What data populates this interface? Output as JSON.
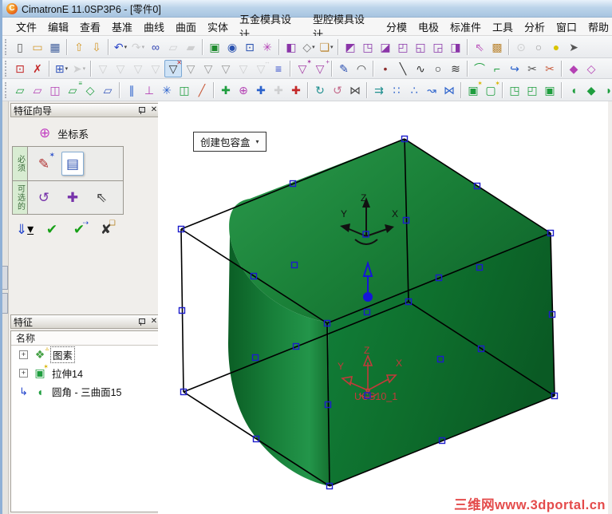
{
  "window": {
    "title": "CimatronE 11.0SP3P6 - [零件0]",
    "logo_glyph": "C"
  },
  "menu": {
    "items": [
      "文件",
      "编辑",
      "查看",
      "基准",
      "曲线",
      "曲面",
      "实体",
      "五金模具设计",
      "型腔模具设计",
      "分模",
      "电极",
      "标准件",
      "工具",
      "分析",
      "窗口",
      "帮助"
    ]
  },
  "toolbars": {
    "row1": [
      {
        "grip": 1
      },
      {
        "n": "new-document-icon",
        "g": "▯",
        "c": "#555"
      },
      {
        "n": "open-document-icon",
        "g": "▭",
        "c": "#d49a2e"
      },
      {
        "n": "save-document-icon",
        "g": "▦",
        "c": "#44629e"
      },
      {
        "sep": 1
      },
      {
        "n": "import-file-icon",
        "g": "⇧",
        "c": "#d49a2e"
      },
      {
        "n": "export-file-icon",
        "g": "⇩",
        "c": "#d49a2e"
      },
      {
        "sep": 1
      },
      {
        "n": "undo-icon",
        "g": "↶",
        "c": "#2b46c8",
        "dd": 1
      },
      {
        "n": "redo-icon",
        "g": "↷",
        "c": "#999",
        "dd": 1,
        "d": 1
      },
      {
        "n": "view-sync-icon",
        "g": "∞",
        "c": "#3346b4"
      },
      {
        "n": "copy-view-icon",
        "g": "▱",
        "c": "#999",
        "d": 1
      },
      {
        "n": "paste-view-icon",
        "g": "▰",
        "c": "#999",
        "d": 1
      },
      {
        "sep": 1
      },
      {
        "n": "render-window-icon",
        "g": "▣",
        "c": "#1d8a2d"
      },
      {
        "n": "zoom-selected-icon",
        "g": "◉",
        "c": "#2a52b0"
      },
      {
        "n": "zoom-window-icon",
        "g": "⊡",
        "c": "#2a52b0"
      },
      {
        "n": "rotate-view-icon",
        "g": "✳",
        "c": "#b441b4"
      },
      {
        "sep": 1
      },
      {
        "n": "shaded-display-icon",
        "g": "◧",
        "c": "#8a35a8"
      },
      {
        "n": "wireframe-display-icon",
        "g": "◇",
        "c": "#777",
        "dd": 1
      },
      {
        "n": "pick-display-icon",
        "g": "❏",
        "c": "#bd8a3a",
        "dd": 1
      },
      {
        "sep": 1
      },
      {
        "n": "view-iso-icon",
        "g": "◩",
        "c": "#8a35a8"
      },
      {
        "n": "view-front-icon",
        "g": "◳",
        "c": "#8a35a8"
      },
      {
        "n": "view-back-icon",
        "g": "◪",
        "c": "#8a35a8"
      },
      {
        "n": "view-left-icon",
        "g": "◰",
        "c": "#8a35a8"
      },
      {
        "n": "view-right-icon",
        "g": "◱",
        "c": "#8a35a8"
      },
      {
        "n": "view-top-icon",
        "g": "◲",
        "c": "#8a35a8"
      },
      {
        "n": "view-bottom-icon",
        "g": "◨",
        "c": "#8a35a8"
      },
      {
        "sep": 1
      },
      {
        "n": "orient-sketch-icon",
        "g": "⇖",
        "c": "#bb55bb"
      },
      {
        "n": "lock-orientation-icon",
        "g": "▩",
        "c": "#bd8a3a"
      },
      {
        "sep": 1
      },
      {
        "n": "ghost-display-icon",
        "g": "⊙",
        "c": "#999",
        "d": 1
      },
      {
        "n": "light-off-icon",
        "g": "○",
        "c": "#999"
      },
      {
        "n": "light-on-icon",
        "g": "●",
        "c": "#d9c400"
      },
      {
        "n": "pick-arrow-icon",
        "g": "➤",
        "c": "#555"
      }
    ],
    "row2": [
      {
        "grip": 1
      },
      {
        "n": "frame-pick-icon",
        "g": "⊡",
        "c": "#c42828"
      },
      {
        "n": "cancel-pick-icon",
        "g": "✗",
        "c": "#c42828"
      },
      {
        "sep": 1
      },
      {
        "n": "add-pick-icon",
        "g": "⊞",
        "c": "#3355bb",
        "dd": 1
      },
      {
        "n": "special-pick-icon",
        "g": "➤",
        "c": "#999",
        "dd": 1,
        "d": 1
      },
      {
        "sep": 1
      },
      {
        "n": "filter-parts-icon",
        "g": "▽",
        "c": "#999",
        "d": 1
      },
      {
        "n": "filter-solids-icon",
        "g": "▽",
        "c": "#999",
        "d": 1
      },
      {
        "n": "filter-faces-icon",
        "g": "▽",
        "c": "#999",
        "d": 1
      },
      {
        "n": "filter-curves-icon",
        "g": "▽",
        "c": "#999",
        "d": 1
      },
      {
        "n": "filter-clear-icon",
        "g": "▽",
        "c": "#333",
        "sel": 1,
        "g2": "✕",
        "c2": "#c42828"
      },
      {
        "n": "filter-edges-icon",
        "g": "▽",
        "c": "#999"
      },
      {
        "n": "filter-points-icon",
        "g": "▽",
        "c": "#999"
      },
      {
        "n": "filter-sketches-icon",
        "g": "▽",
        "c": "#999"
      },
      {
        "n": "filter-dims-icon",
        "g": "▽",
        "c": "#999",
        "d": 1
      },
      {
        "n": "filter-range-icon",
        "g": "▽",
        "c": "#999",
        "d": 1,
        "g2": "↔",
        "c2": "#999"
      },
      {
        "n": "filter-settings-icon",
        "g": "≡",
        "c": "#2b46c8"
      },
      {
        "sep": 1
      },
      {
        "n": "quick-filter-icon",
        "g": "▽",
        "c": "#a53fa5",
        "g2": "✶",
        "c2": "#a53fa5"
      },
      {
        "n": "add-filter-icon",
        "g": "▽",
        "c": "#a53fa5",
        "g2": "+",
        "c2": "#a53fa5"
      },
      {
        "sep": 1
      },
      {
        "n": "sketcher-icon",
        "g": "✎",
        "c": "#2b4fb0"
      },
      {
        "n": "open-profile-icon",
        "g": "◠",
        "c": "#444"
      },
      {
        "sep": 1
      },
      {
        "n": "point-icon",
        "g": "•",
        "c": "#8d2f2f"
      },
      {
        "n": "line-icon",
        "g": "╲",
        "c": "#333"
      },
      {
        "n": "spline-icon",
        "g": "∿",
        "c": "#333"
      },
      {
        "n": "circle-icon",
        "g": "○",
        "c": "#333"
      },
      {
        "n": "coil-icon",
        "g": "≋",
        "c": "#333"
      },
      {
        "sep": 1
      },
      {
        "n": "fillet-curve-icon",
        "g": "⌒",
        "c": "#1f9e3f"
      },
      {
        "n": "corner-round-icon",
        "g": "⌐",
        "c": "#1f9e3f"
      },
      {
        "n": "extend-curve-icon",
        "g": "↪",
        "c": "#2b62cc"
      },
      {
        "n": "trim-curve-icon",
        "g": "✂",
        "c": "#555"
      },
      {
        "n": "divide-curve-icon",
        "g": "✂",
        "c": "#c85a3a"
      },
      {
        "sep": 1
      },
      {
        "n": "drive-surface-icon",
        "g": "◆",
        "c": "#b441b4"
      },
      {
        "n": "ruled-surface-icon",
        "g": "◇",
        "c": "#b441b4"
      }
    ],
    "row3": [
      {
        "grip": 1
      },
      {
        "n": "plane-parallel-icon",
        "g": "▱",
        "c": "#1f9e3f"
      },
      {
        "n": "plane-fold-icon",
        "g": "▱",
        "c": "#b441b4"
      },
      {
        "n": "plane-mid-icon",
        "g": "◫",
        "c": "#b441b4"
      },
      {
        "n": "plane-offset-icon",
        "g": "▱",
        "c": "#1f9e3f",
        "g2": "≡",
        "c2": "#1f9e3f"
      },
      {
        "n": "plane-angle-icon",
        "g": "◇",
        "c": "#1f9e3f"
      },
      {
        "n": "plane-points-icon",
        "g": "▱",
        "c": "#3355bb"
      },
      {
        "sep": 1
      },
      {
        "n": "line-2pts-icon",
        "g": "∥",
        "c": "#2b62cc"
      },
      {
        "n": "axis-point-icon",
        "g": "⊥",
        "c": "#b441b4"
      },
      {
        "n": "axis-center-icon",
        "g": "✳",
        "c": "#2b62cc"
      },
      {
        "n": "axis-planes-icon",
        "g": "◫",
        "c": "#1f9e3f"
      },
      {
        "n": "axis-angle-icon",
        "g": "╱",
        "c": "#c85a3a"
      },
      {
        "sep": 1
      },
      {
        "n": "ucs-geometry-icon",
        "g": "✚",
        "c": "#1f9e3f"
      },
      {
        "n": "ucs-circle-icon",
        "g": "⊕",
        "c": "#b441b4"
      },
      {
        "n": "ucs-origin-icon",
        "g": "✚",
        "c": "#2b62cc"
      },
      {
        "n": "ucs-translate-icon",
        "g": "✚",
        "c": "#999",
        "d": 1
      },
      {
        "n": "ucs-pick-icon",
        "g": "✚",
        "c": "#c42828"
      },
      {
        "sep": 1
      },
      {
        "n": "move-copy-icon",
        "g": "↻",
        "c": "#1f8f8f"
      },
      {
        "n": "rotate-copy-icon",
        "g": "↺",
        "c": "#c46a8a"
      },
      {
        "n": "mirror-icon",
        "g": "⋈",
        "c": "#444"
      },
      {
        "sep": 1
      },
      {
        "n": "translate-icon",
        "g": "⇉",
        "c": "#1f8f8f"
      },
      {
        "n": "pattern-grid-icon",
        "g": "∷",
        "c": "#2b62cc"
      },
      {
        "n": "pattern-radial-icon",
        "g": "∴",
        "c": "#2b62cc"
      },
      {
        "n": "pattern-curve-icon",
        "g": "↝",
        "c": "#2b62cc"
      },
      {
        "n": "mirror-pattern-icon",
        "g": "⋈",
        "c": "#2b62cc"
      },
      {
        "sep": 1
      },
      {
        "n": "new-solid-icon",
        "g": "▣",
        "c": "#1f9e3f",
        "g2": "✶",
        "c2": "#d8b400"
      },
      {
        "n": "new-sheet-icon",
        "g": "▢",
        "c": "#1f9e3f",
        "g2": "✶",
        "c2": "#d8b400"
      },
      {
        "sep": 1
      },
      {
        "n": "solid-remove-icon",
        "g": "◳",
        "c": "#1f9e3f"
      },
      {
        "n": "solid-add-icon",
        "g": "◰",
        "c": "#1f9e3f"
      },
      {
        "n": "solid-intersect-icon",
        "g": "▣",
        "c": "#1f9e3f"
      },
      {
        "sep": 1
      },
      {
        "n": "round-icon",
        "g": "◖",
        "c": "#1f9e3f"
      },
      {
        "n": "chamfer-icon",
        "g": "◆",
        "c": "#1f9e3f"
      },
      {
        "n": "draft-icon",
        "g": "◗",
        "c": "#1f9e3f"
      }
    ]
  },
  "wizard": {
    "title": "特征向导",
    "close_glyph": "✕",
    "step_label": "坐标系",
    "step_icon_glyph": "⊕",
    "required_label": "必须",
    "required_icons": [
      {
        "n": "define-by-sketch-icon",
        "g": "✎",
        "c": "#b03030",
        "g2": "✶",
        "c2": "#3355cc"
      },
      {
        "n": "define-by-dialog-icon",
        "g": "▤",
        "c": "#2b4fb0",
        "sel": 1
      }
    ],
    "optional_label": "可选的",
    "optional_icons": [
      {
        "n": "rotate-ucs-icon",
        "g": "↺",
        "c": "#7733aa"
      },
      {
        "n": "move-ucs-icon",
        "g": "✚",
        "c": "#7733aa"
      },
      {
        "n": "pick-ucs-icon",
        "g": "⇖",
        "c": "#444"
      }
    ],
    "actions": [
      {
        "n": "apply-options-button",
        "g": "⇓",
        "c": "#2244cc",
        "dd": 1
      },
      {
        "n": "ok-button",
        "g": "✔",
        "c": "#17a017"
      },
      {
        "n": "ok-continue-button",
        "g": "✔",
        "c": "#17a017",
        "g2": "⇢",
        "c2": "#2244cc"
      },
      {
        "n": "cancel-button",
        "g": "✘",
        "c": "#333",
        "g2": "❏",
        "c2": "#b8862b"
      }
    ]
  },
  "features": {
    "title": "特征",
    "close_glyph": "✕",
    "column_header": "名称",
    "items": [
      {
        "expander": "+",
        "icon_name": "primitives-icon",
        "g": "❖",
        "c": "#44a044",
        "g2": "▵",
        "c2": "#d8a800",
        "label": "图素",
        "focused": true
      },
      {
        "expander": "+",
        "icon_name": "extrude-feature-icon",
        "g": "▣",
        "c": "#1f9e3f",
        "g2": "✶",
        "c2": "#d8b400",
        "label": "拉伸14",
        "focused": false
      },
      {
        "expander": "arrow",
        "icon_name": "round-feature-icon",
        "g": "◖",
        "c": "#1f9e3f",
        "label": "圆角 - 三曲面15",
        "focused": false
      }
    ]
  },
  "viewport": {
    "button_label": "创建包容盒",
    "triad": {
      "x": "X",
      "y": "Y",
      "z": "Z"
    },
    "ucs": {
      "x": "X",
      "y": "Y",
      "z": "Z",
      "label": "UCS10_1"
    },
    "watermark": "三维网www.3dportal.cn"
  },
  "colors": {
    "model_green_top": "#2b9a4c",
    "model_green_dark": "#0b5e25",
    "handle_blue": "#1c1ccc",
    "direction_blue": "#1515d8",
    "ucs_red": "#c23a3a",
    "watermark_red": "#e44b4b",
    "titlebar_blue": "#bcd4ea"
  }
}
